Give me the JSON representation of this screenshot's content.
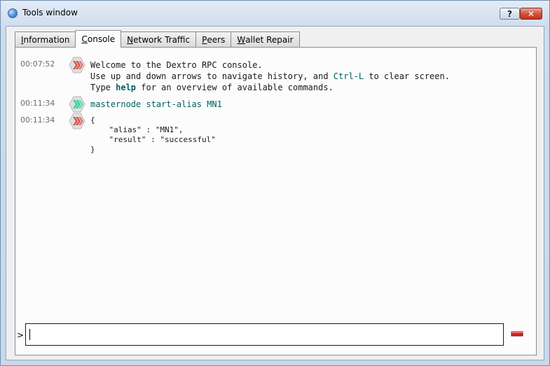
{
  "window": {
    "title": "Tools window",
    "help_label": "?",
    "close_label": "✕",
    "icon": "app-icon"
  },
  "tabs": [
    {
      "label": "Information",
      "mnemonic": "I",
      "rest": "nformation",
      "active": false
    },
    {
      "label": "Console",
      "mnemonic": "C",
      "rest": "onsole",
      "active": true
    },
    {
      "label": "Network Traffic",
      "mnemonic": "N",
      "rest": "etwork Traffic",
      "active": false
    },
    {
      "label": "Peers",
      "mnemonic": "P",
      "rest": "eers",
      "active": false
    },
    {
      "label": "Wallet Repair",
      "mnemonic": "W",
      "rest": "allet Repair",
      "active": false
    }
  ],
  "console": {
    "messages": [
      {
        "timestamp": "00:07:52",
        "icon": "reply-icon",
        "line1": "Welcome to the Dextro RPC console.",
        "line2_pre": "Use up and down arrows to navigate history, and ",
        "line2_key": "Ctrl-L",
        "line2_post": " to clear screen.",
        "line3_pre": "Type ",
        "line3_key": "help",
        "line3_post": " for an overview of available commands."
      },
      {
        "timestamp": "00:11:34",
        "icon": "request-icon",
        "command": "masternode start-alias MN1"
      },
      {
        "timestamp": "00:11:34",
        "icon": "reply-icon",
        "json_lines": [
          "{",
          "    \"alias\" : \"MN1\",",
          "    \"result\" : \"successful\"",
          "}"
        ]
      }
    ],
    "prompt": ">",
    "input_value": "",
    "clear_icon": "clear-console-icon"
  },
  "colors": {
    "reply_icon": "#d9534f",
    "request_icon": "#2fd39a",
    "keyword": "#006060",
    "timestamp": "#6e6e6e"
  }
}
